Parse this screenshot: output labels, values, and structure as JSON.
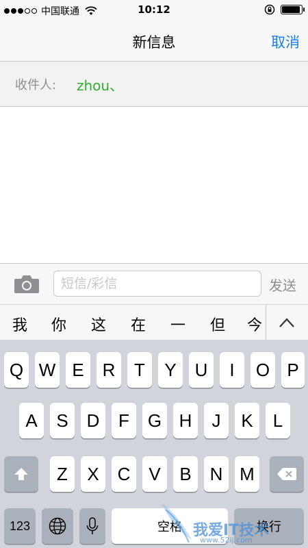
{
  "status": {
    "carrier": "中国联通",
    "time": "10:12"
  },
  "nav": {
    "title": "新信息",
    "cancel": "取消"
  },
  "recipient": {
    "label": "收件人:",
    "name": "zhou、"
  },
  "compose": {
    "placeholder": "短信/彩信",
    "send": "发送"
  },
  "suggestions": [
    "我",
    "你",
    "这",
    "在",
    "一",
    "但",
    "今"
  ],
  "keyboard": {
    "row1": [
      "Q",
      "W",
      "E",
      "R",
      "T",
      "Y",
      "U",
      "I",
      "O",
      "P"
    ],
    "row2": [
      "A",
      "S",
      "D",
      "F",
      "G",
      "H",
      "J",
      "K",
      "L"
    ],
    "row3": [
      "Z",
      "X",
      "C",
      "V",
      "B",
      "N",
      "M"
    ],
    "numbers": "123",
    "space": "空格",
    "return": "换行"
  },
  "watermark": {
    "text": "我爱IT技术",
    "sub": "www.52ij.com"
  },
  "colors": {
    "accent": "#1a7ef5",
    "recipient": "#2db22d",
    "keyboard_bg": "#d1d5db"
  }
}
